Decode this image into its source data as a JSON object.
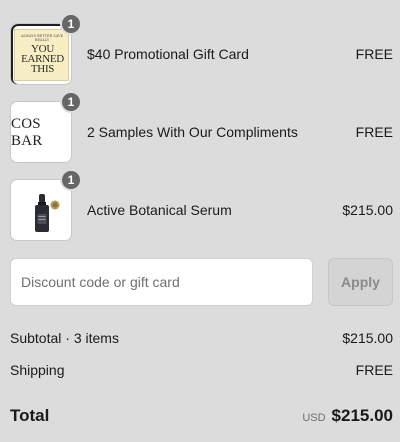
{
  "line_items": [
    {
      "name": "$40 Promotional Gift Card",
      "price": "FREE",
      "quantity": "1",
      "thumb_text_small": "ALWAYS BETTER SAVE REALLY",
      "thumb_text_big": "YOU EARNED THIS",
      "icon": "gift-card-icon"
    },
    {
      "name": "2 Samples With Our Compliments",
      "price": "FREE",
      "quantity": "1",
      "thumb_text": "COS BAR",
      "icon": "cos-bar-logo"
    },
    {
      "name": "Active Botanical Serum",
      "price": "$215.00",
      "quantity": "1",
      "icon": "serum-bottle-icon"
    }
  ],
  "discount": {
    "placeholder": "Discount code or gift card",
    "value": "",
    "apply_label": "Apply"
  },
  "summary": {
    "subtotal_label": "Subtotal · 3 items",
    "subtotal_value": "$215.00",
    "shipping_label": "Shipping",
    "shipping_value": "FREE",
    "total_label": "Total",
    "currency": "USD",
    "total_value": "$215.00"
  },
  "colors": {
    "background": "#dcdcdc",
    "badge": "#666666",
    "apply_disabled": "#d4d4d4"
  }
}
